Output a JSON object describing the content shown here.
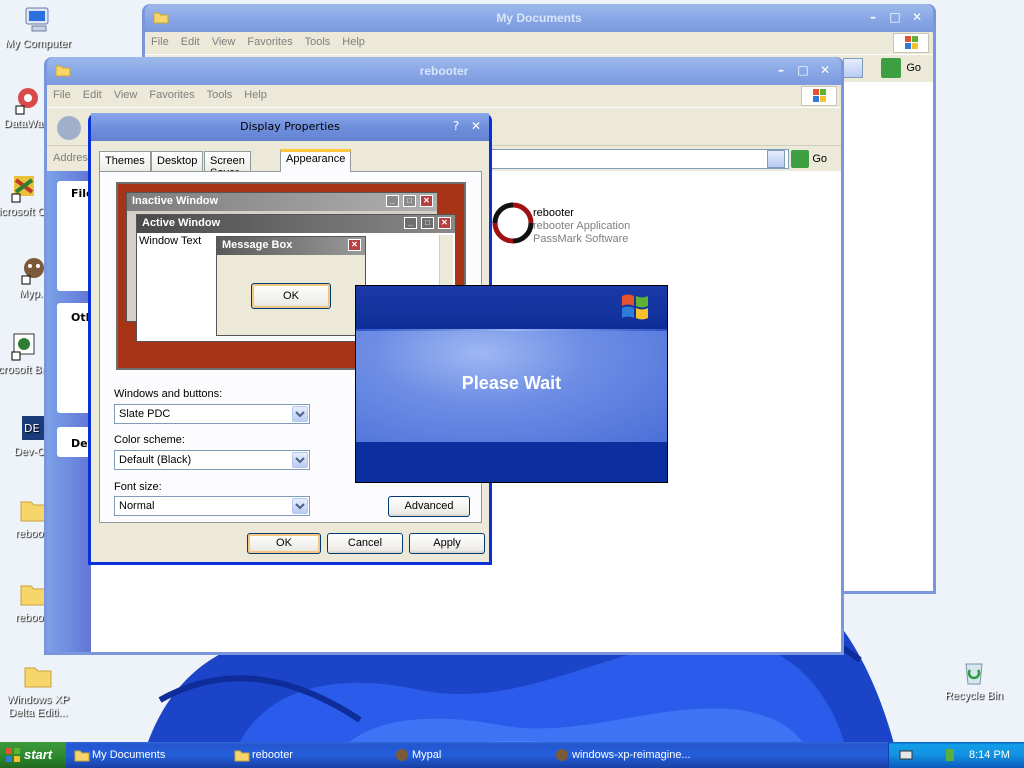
{
  "desktop": {
    "icons": [
      {
        "label": "My Computer",
        "icon": "computer-icon"
      },
      {
        "label": "DataWa...",
        "icon": "datawatch-shortcut-icon"
      },
      {
        "label": "Microsoft C++",
        "icon": "msvc-shortcut-icon"
      },
      {
        "label": "Myp...",
        "icon": "mypal-shortcut-icon"
      },
      {
        "label": "Microsoft Basic",
        "icon": "msbasic-shortcut-icon"
      },
      {
        "label": "Dev-C...",
        "icon": "devcpp-shortcut-icon"
      },
      {
        "label": "reboo...",
        "icon": "folder-icon"
      },
      {
        "label": "reboo...",
        "icon": "folder-icon"
      },
      {
        "label": "Windows XP Delta Editi...",
        "icon": "folder-icon"
      },
      {
        "label": "Recycle Bin",
        "icon": "recycle-bin-icon"
      }
    ]
  },
  "windows": {
    "my_documents": {
      "title": "My Documents",
      "menu": [
        "File",
        "Edit",
        "View",
        "Favorites",
        "Tools",
        "Help"
      ],
      "go_label": "Go"
    },
    "rebooter": {
      "title": "rebooter",
      "menu": [
        "File",
        "Edit",
        "View",
        "Favorites",
        "Tools",
        "Help"
      ],
      "address_label": "Addres",
      "go_label": "Go",
      "sidebar_headings": [
        "File",
        "Oth",
        "Det"
      ],
      "file_item": {
        "name": "rebooter",
        "type": "rebooter Application",
        "company": "PassMark Software"
      }
    }
  },
  "display_properties": {
    "title": "Display Properties",
    "help_glyph": "?",
    "tabs": [
      "Themes",
      "Desktop",
      "Screen Saver",
      "Appearance"
    ],
    "selected_tab": "Appearance",
    "preview": {
      "inactive_title": "Inactive Window",
      "active_title": "Active Window",
      "window_text": "Window Text",
      "message_box_title": "Message Box",
      "ok_label": "OK"
    },
    "windows_buttons_label": "Windows and buttons:",
    "windows_buttons_value": "Slate PDC",
    "color_scheme_label": "Color scheme:",
    "color_scheme_value": "Default (Black)",
    "font_size_label": "Font size:",
    "font_size_value": "Normal",
    "advanced_label": "Advanced",
    "ok_label": "OK",
    "cancel_label": "Cancel",
    "apply_label": "Apply"
  },
  "please_wait": {
    "message": "Please Wait"
  },
  "taskbar": {
    "start_label": "start",
    "tasks": [
      "My Documents",
      "rebooter",
      "Mypal",
      "windows-xp-reimagine..."
    ],
    "clock": "8:14 PM"
  },
  "colors": {
    "xp_blue_title": "#0a4ce0",
    "preview_desktop": "#a83418",
    "please_wait_band": "#0b2f9e"
  }
}
